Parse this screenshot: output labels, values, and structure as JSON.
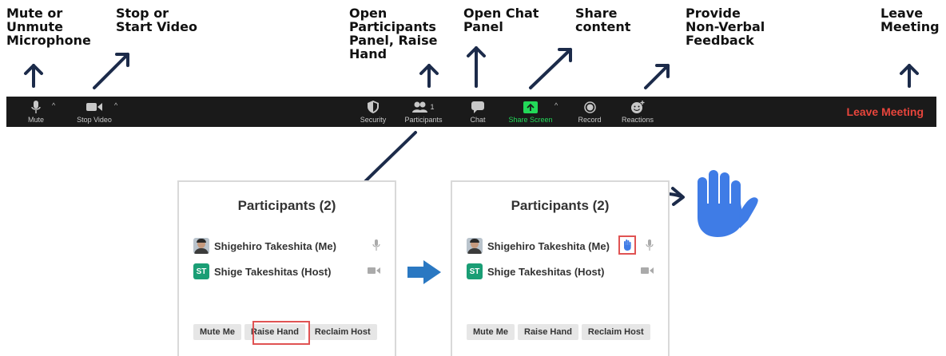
{
  "annotations": {
    "mute": "Mute or\nUnmute\nMicrophone",
    "video": "Stop or\nStart Video",
    "participants": "Open\nParticipants\nPanel, Raise\nHand",
    "chat": "Open Chat\nPanel",
    "share": "Share\ncontent",
    "reactions": "Provide\nNon-Verbal\nFeedback",
    "leave": "Leave\nMeeting"
  },
  "toolbar": {
    "mute_label": "Mute",
    "video_label": "Stop Video",
    "security_label": "Security",
    "participants_label": "Participants",
    "participants_count": "1",
    "chat_label": "Chat",
    "share_label": "Share Screen",
    "record_label": "Record",
    "reactions_label": "Reactions",
    "leave_label": "Leave Meeting",
    "caret": "^"
  },
  "panel_before": {
    "title": "Participants (2)",
    "participants": [
      {
        "name": "Shigehiro Takeshita (Me)"
      },
      {
        "initials": "ST",
        "name": "Shige Takeshitas (Host)"
      }
    ],
    "buttons": [
      "Mute Me",
      "Raise Hand",
      "Reclaim Host"
    ]
  },
  "panel_after": {
    "title": "Participants (2)",
    "participants": [
      {
        "name": "Shigehiro Takeshita (Me)"
      },
      {
        "initials": "ST",
        "name": "Shige Takeshitas (Host)"
      }
    ],
    "buttons": [
      "Mute Me",
      "Raise Hand",
      "Reclaim Host"
    ]
  },
  "colors": {
    "toolbar_bg": "#1a1a1a",
    "leave_red": "#e8453c",
    "share_green": "#23d959",
    "arrow_navy": "#1c2b4a",
    "transition_arrow": "#2a78c2",
    "hand_blue": "#3f7ce6",
    "highlight_red": "#e05353",
    "host_avatar": "#1a9e75"
  }
}
